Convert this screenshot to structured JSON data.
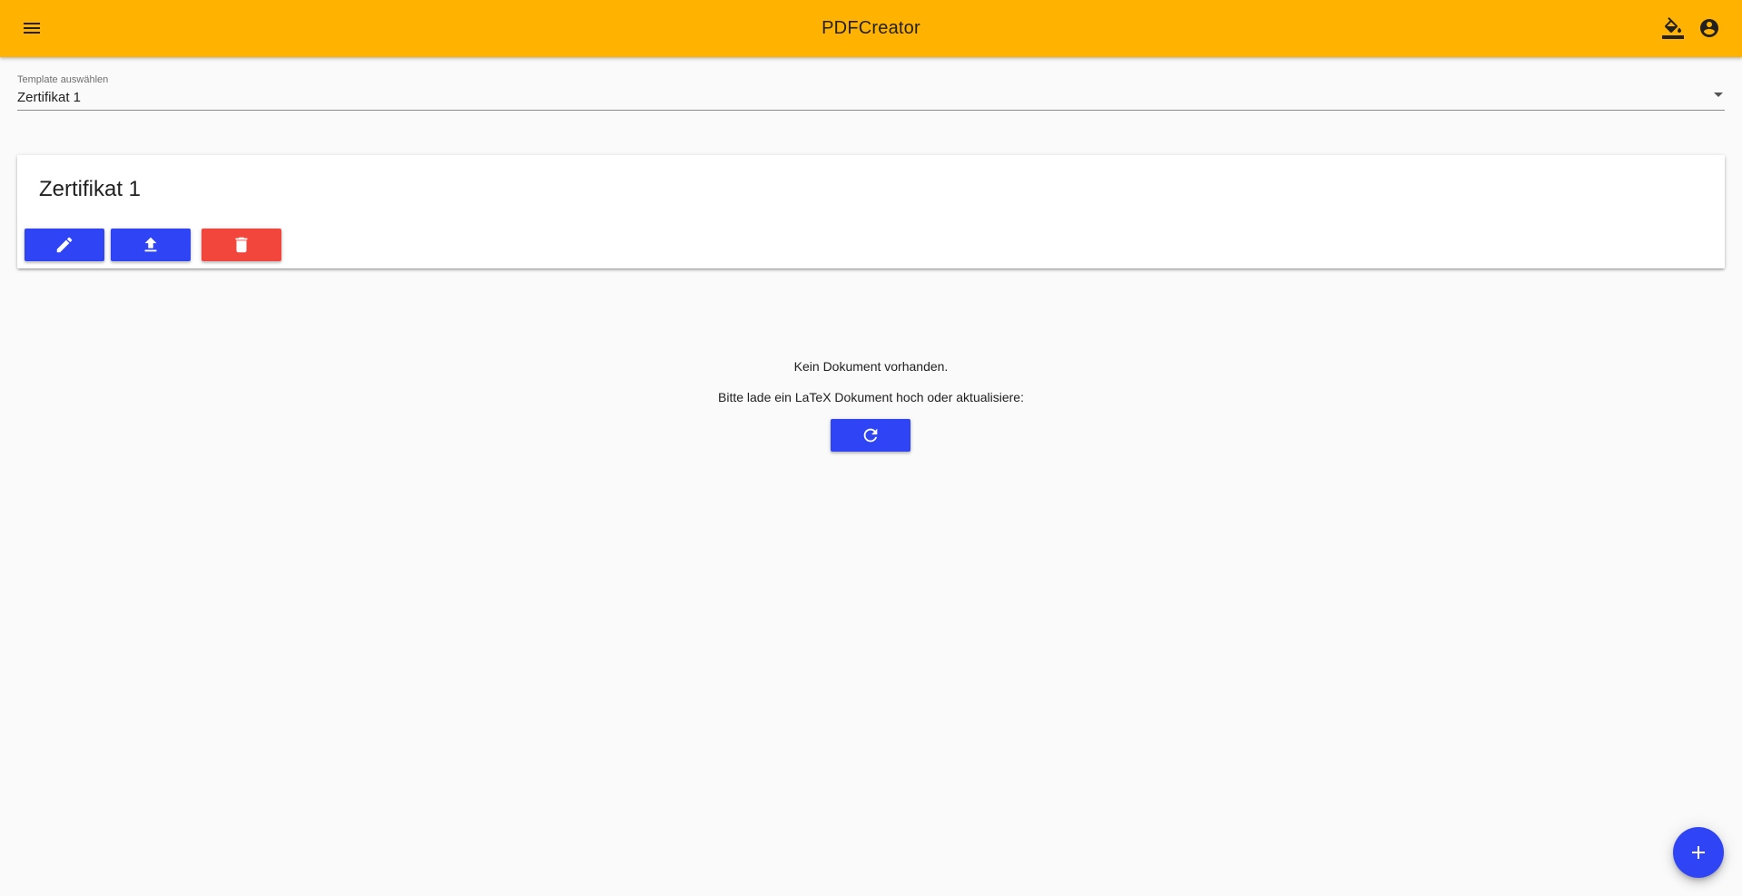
{
  "app": {
    "title": "PDFCreator",
    "accent_color": "#ffb300",
    "primary_color": "#2f45f5",
    "danger_color": "#f2453b"
  },
  "header": {
    "menu_icon": "menu-icon",
    "theme_icon": "format-color-fill-icon",
    "account_icon": "account-circle-icon"
  },
  "template_select": {
    "label": "Template auswählen",
    "selected": "Zertifikat 1"
  },
  "template_card": {
    "title": "Zertifikat 1",
    "actions": [
      {
        "icon": "pencil-icon"
      },
      {
        "icon": "upload-icon"
      },
      {
        "icon": "trash-icon"
      }
    ]
  },
  "empty_state": {
    "line1": "Kein Dokument vorhanden.",
    "line2": "Bitte lade ein LaTeX Dokument hoch oder aktualisiere:",
    "refresh_icon": "refresh-icon"
  },
  "fab": {
    "icon": "plus-icon"
  }
}
